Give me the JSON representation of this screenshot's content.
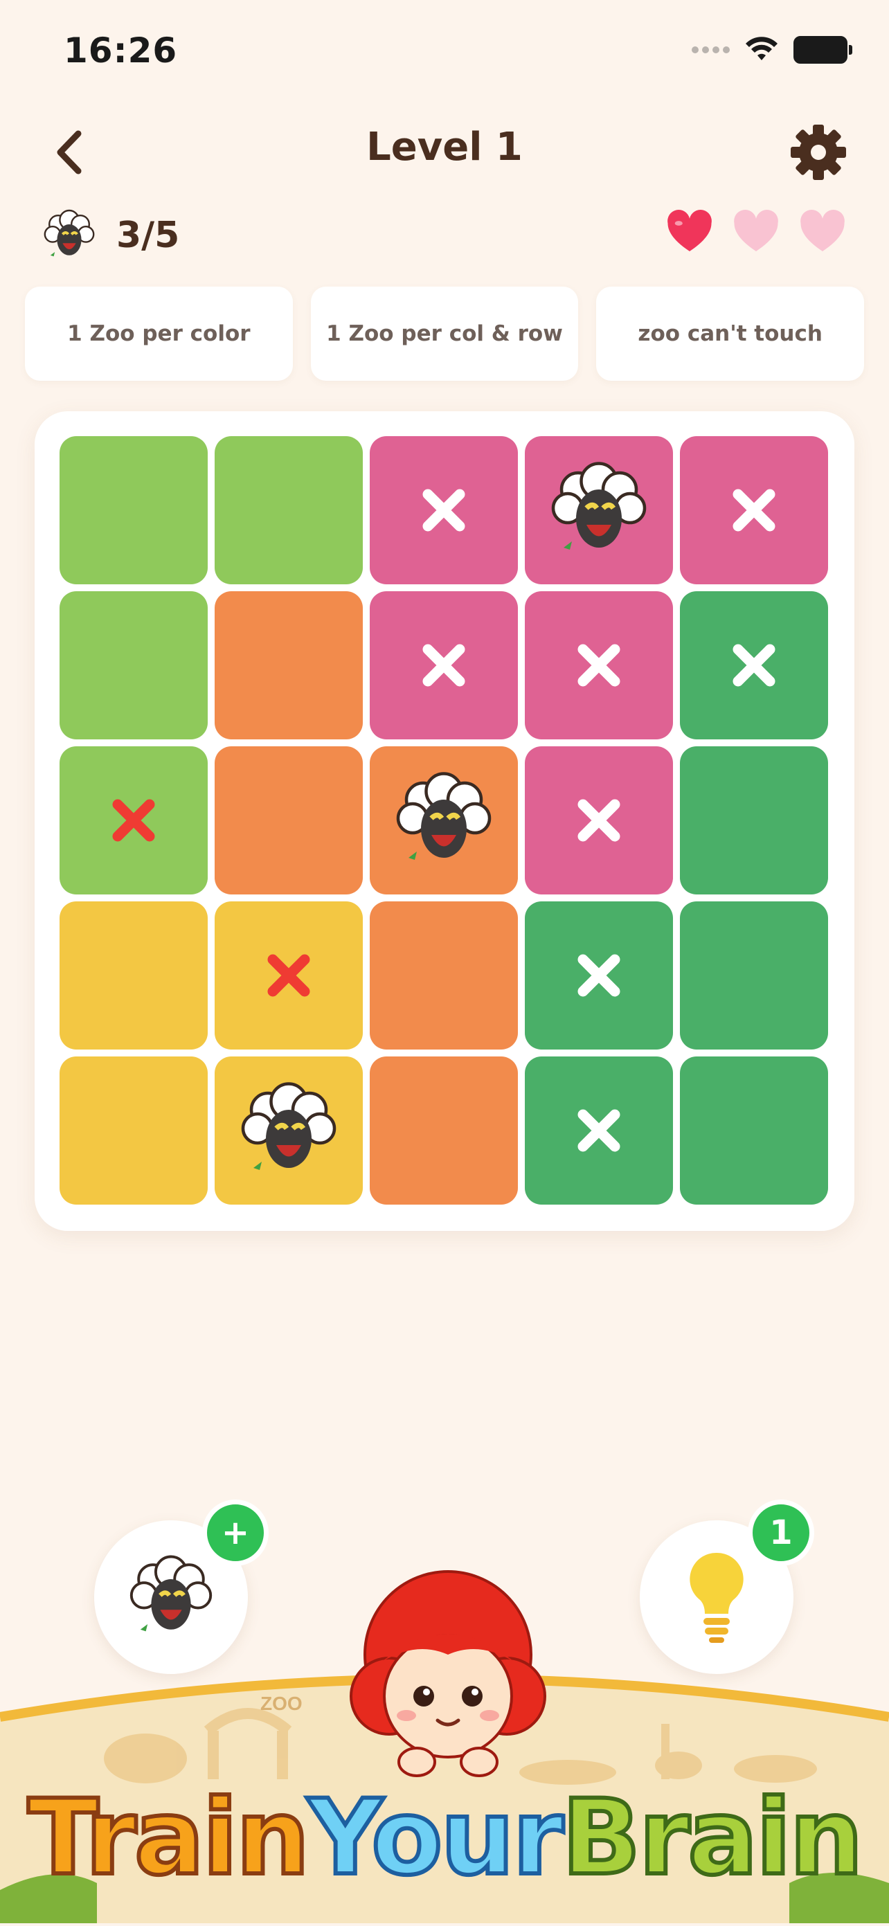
{
  "status_bar": {
    "time": "16:26"
  },
  "header": {
    "title": "Level 1"
  },
  "progress": {
    "counter": "3/5",
    "lives_total": 3,
    "lives_remaining": 1
  },
  "rules": [
    "1 Zoo per color",
    "1 Zoo per col & row",
    "zoo can't touch"
  ],
  "colors": {
    "background": "#fdf4ec",
    "light_green": "#8fc95b",
    "pink": "#df6293",
    "orange": "#f28b4c",
    "dark_green": "#4aaf68",
    "yellow": "#f3c743",
    "heart_full": "#f0355a",
    "heart_empty": "#f9c3d2",
    "badge_green": "#2fc055"
  },
  "board": {
    "rows": [
      [
        {
          "color": "light_green",
          "mark": ""
        },
        {
          "color": "light_green",
          "mark": ""
        },
        {
          "color": "pink",
          "mark": "x"
        },
        {
          "color": "pink",
          "mark": "sheep"
        },
        {
          "color": "pink",
          "mark": "x"
        }
      ],
      [
        {
          "color": "light_green",
          "mark": ""
        },
        {
          "color": "orange",
          "mark": ""
        },
        {
          "color": "pink",
          "mark": "x"
        },
        {
          "color": "pink",
          "mark": "x"
        },
        {
          "color": "dark_green",
          "mark": "x"
        }
      ],
      [
        {
          "color": "light_green",
          "mark": "red-x"
        },
        {
          "color": "orange",
          "mark": ""
        },
        {
          "color": "orange",
          "mark": "sheep"
        },
        {
          "color": "pink",
          "mark": "x"
        },
        {
          "color": "dark_green",
          "mark": ""
        }
      ],
      [
        {
          "color": "yellow",
          "mark": ""
        },
        {
          "color": "yellow",
          "mark": "red-x"
        },
        {
          "color": "orange",
          "mark": ""
        },
        {
          "color": "dark_green",
          "mark": "x"
        },
        {
          "color": "dark_green",
          "mark": ""
        }
      ],
      [
        {
          "color": "yellow",
          "mark": ""
        },
        {
          "color": "yellow",
          "mark": "sheep"
        },
        {
          "color": "orange",
          "mark": ""
        },
        {
          "color": "dark_green",
          "mark": "x"
        },
        {
          "color": "dark_green",
          "mark": ""
        }
      ]
    ]
  },
  "actions": {
    "add_sheep_badge": "+",
    "hint_badge": "1"
  },
  "banner": {
    "word1": "Train",
    "word2": "Your",
    "word3": "Brain",
    "sign": "ZOO"
  }
}
